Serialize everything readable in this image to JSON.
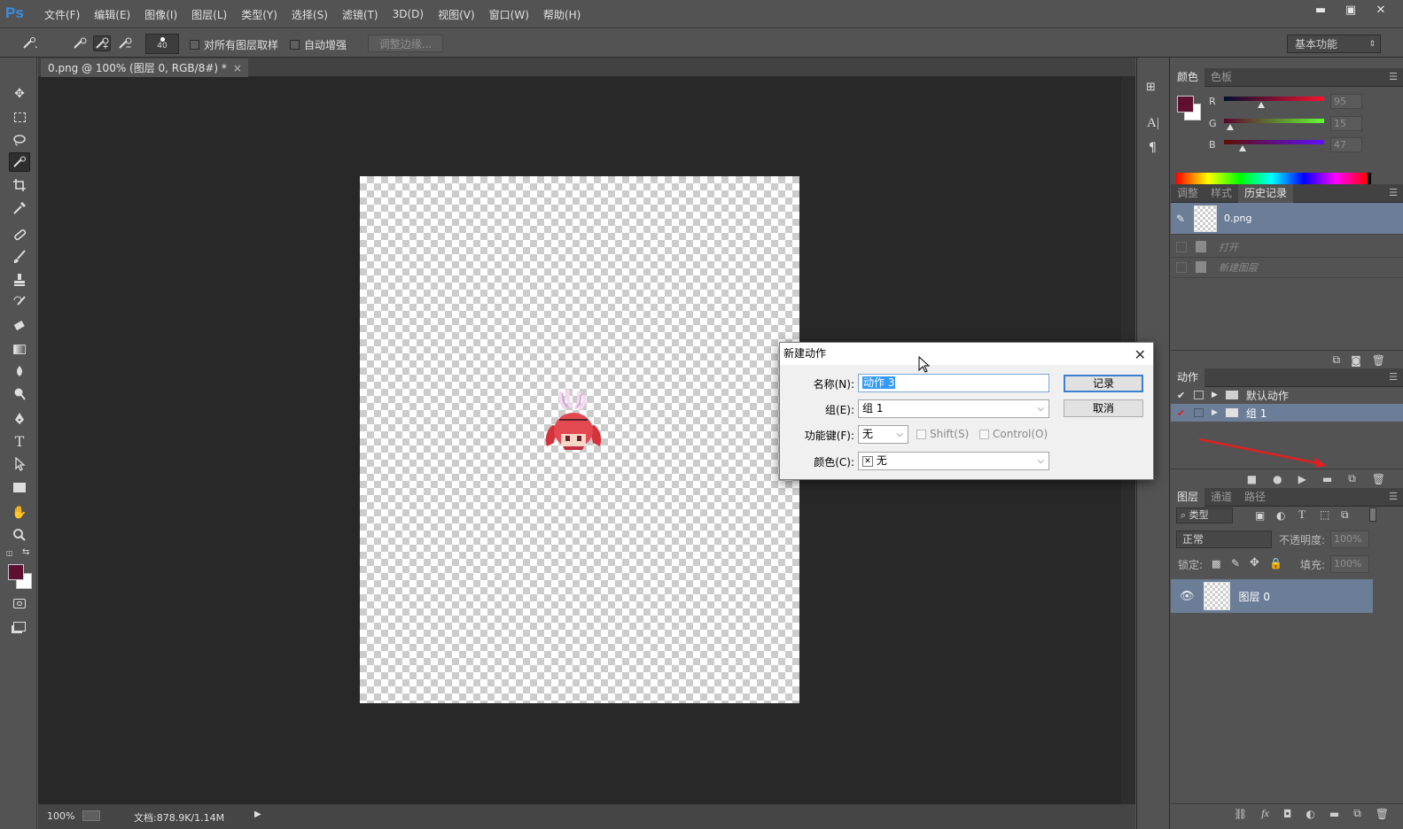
{
  "app": {
    "logo": "Ps"
  },
  "menu": [
    "文件(F)",
    "编辑(E)",
    "图像(I)",
    "图层(L)",
    "类型(Y)",
    "选择(S)",
    "滤镜(T)",
    "3D(D)",
    "视图(V)",
    "窗口(W)",
    "帮助(H)"
  ],
  "window_buttons": {
    "minimize": "▬",
    "maximize": "▣",
    "close": "✕"
  },
  "options": {
    "brush_size": "40",
    "sample_all_layers": "对所有图层取样",
    "auto_enhance": "自动增强",
    "refine_edge": "调整边缘...",
    "workspace": "基本功能"
  },
  "document": {
    "tab_title": "0.png @ 100% (图层 0, RGB/8#) *",
    "tab_close": "×",
    "zoom": "100%",
    "doc_size": "文档:878.9K/1.14M"
  },
  "color_panel": {
    "tabs": [
      "颜色",
      "色板"
    ],
    "r_label": "R",
    "g_label": "G",
    "b_label": "B",
    "r": "95",
    "g": "15",
    "b": "47",
    "foreground": "#5f0f2f",
    "background": "#ffffff"
  },
  "history_panel": {
    "tabs": [
      "调整",
      "样式",
      "历史记录"
    ],
    "snapshot": "0.png",
    "steps": [
      "打开",
      "新建图层"
    ]
  },
  "actions_panel": {
    "title": "动作",
    "sets": [
      "默认动作",
      "组 1"
    ]
  },
  "layers_panel": {
    "tabs": [
      "图层",
      "通道",
      "路径"
    ],
    "filter": "类型",
    "blend_mode": "正常",
    "opacity_label": "不透明度:",
    "opacity": "100%",
    "lock_label": "锁定:",
    "fill_label": "填充:",
    "fill": "100%",
    "layers": [
      "图层 0"
    ]
  },
  "dialog": {
    "title": "新建动作",
    "name_label": "名称(N):",
    "name_value": "动作 3",
    "group_label": "组(E):",
    "group_value": "组 1",
    "fkey_label": "功能键(F):",
    "fkey_value": "无",
    "shift_label": "Shift(S)",
    "control_label": "Control(O)",
    "color_label": "颜色(C):",
    "color_value": "无",
    "record_button": "记录",
    "cancel_button": "取消"
  }
}
